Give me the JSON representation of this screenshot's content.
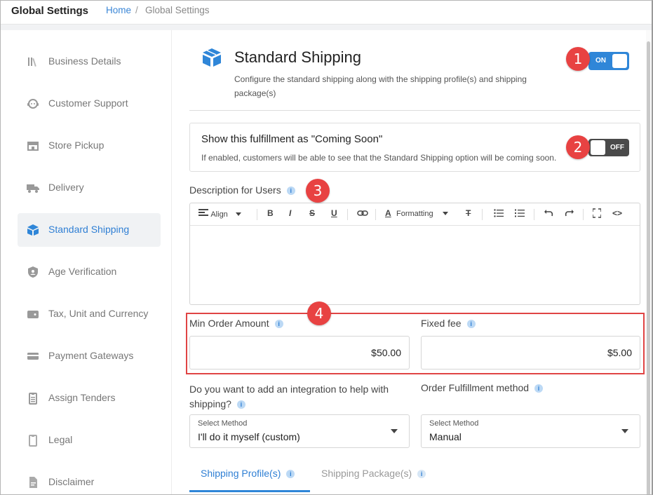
{
  "header": {
    "app_title": "Global Settings",
    "breadcrumb_home": "Home",
    "breadcrumb_sep": "/",
    "breadcrumb_current": "Global Settings"
  },
  "sidebar": {
    "items": [
      {
        "label": "Business Details",
        "icon": "books-icon"
      },
      {
        "label": "Customer Support",
        "icon": "support-agent-icon"
      },
      {
        "label": "Store Pickup",
        "icon": "store-icon"
      },
      {
        "label": "Delivery",
        "icon": "delivery-truck-icon"
      },
      {
        "label": "Standard Shipping",
        "icon": "package-icon",
        "active": true
      },
      {
        "label": "Age Verification",
        "icon": "shield-user-icon"
      },
      {
        "label": "Tax, Unit and Currency",
        "icon": "wallet-icon"
      },
      {
        "label": "Payment Gateways",
        "icon": "credit-card-icon"
      },
      {
        "label": "Assign Tenders",
        "icon": "clipboard-list-icon"
      },
      {
        "label": "Legal",
        "icon": "clipboard-icon"
      },
      {
        "label": "Disclaimer",
        "icon": "document-icon"
      }
    ]
  },
  "shipping": {
    "title": "Standard Shipping",
    "description": "Configure the standard shipping along with the shipping profile(s) and shipping package(s)",
    "enabled_label": "ON"
  },
  "coming_soon": {
    "title": "Show this fulfillment as \"Coming Soon\"",
    "description": "If enabled, customers will be able to see that the Standard Shipping option will be coming soon.",
    "toggle_label": "OFF"
  },
  "description_field": {
    "label": "Description for Users",
    "toolbar": {
      "align": "Align",
      "formatting": "Formatting"
    }
  },
  "min_order": {
    "label": "Min Order Amount",
    "value": "$50.00"
  },
  "fixed_fee": {
    "label": "Fixed fee",
    "value": "$5.00"
  },
  "integration": {
    "label_line1": "Do you want to add an integration to help with",
    "label_line2": "shipping?",
    "select_label": "Select Method",
    "select_value": "I'll do it myself (custom)"
  },
  "fulfillment": {
    "label": "Order Fulfillment method",
    "select_label": "Select Method",
    "select_value": "Manual"
  },
  "tabs": [
    {
      "label": "Shipping Profile(s)",
      "active": true
    },
    {
      "label": "Shipping Package(s)",
      "active": false
    }
  ],
  "badges": [
    "1",
    "2",
    "3",
    "4"
  ],
  "colors": {
    "accent": "#2f86d8",
    "badge": "#e84242",
    "toggle_off": "#4a4a4a"
  }
}
